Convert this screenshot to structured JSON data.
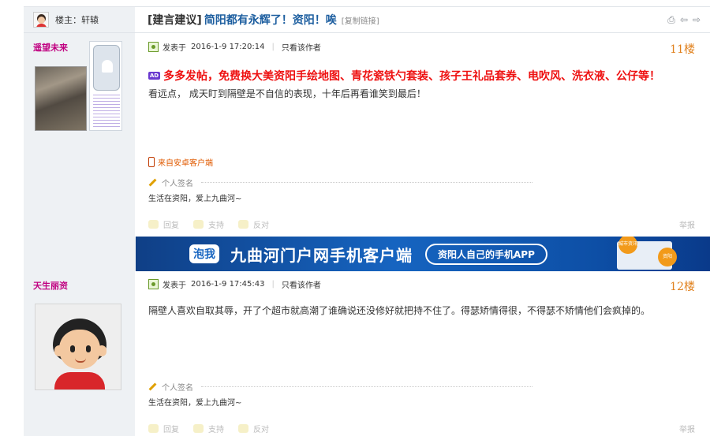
{
  "thread": {
    "op_label": "楼主：轩辕",
    "category": "[建言建议]",
    "title": "简阳都有永辉了！资阳！唉",
    "copy_link": "[复制链接]",
    "tool_icons": [
      "print-icon",
      "prev-thread-icon",
      "next-thread-icon"
    ]
  },
  "posts": [
    {
      "author": "遥望未来",
      "posted_label": "发表于",
      "posted_at": "2016-1-9 17:20:14",
      "author_only": "只看该作者",
      "floor": "11楼",
      "ad_badge": "AD",
      "ad_text": "多多发帖，免费换大美资阳手绘地图、青花瓷铁勺套装、孩子王礼品套券、电吹风、洗衣液、公仔等！",
      "body": "看远点， 成天盯到隔壁是不自信的表现，十年后再看谁笑到最后！",
      "client": "来自安卓客户端",
      "sig_label": "个人签名",
      "signature": "生活在资阳，爱上九曲河~",
      "actions": [
        "回复",
        "支持",
        "反对"
      ],
      "report": "举报"
    },
    {
      "author": "天生丽资",
      "posted_label": "发表于",
      "posted_at": "2016-1-9 17:45:43",
      "author_only": "只看该作者",
      "floor": "12楼",
      "body": "隔壁人喜欢自取其辱，开了个超市就高潮了谁确说还没修好就把持不住了。得瑟矫情得很，不得瑟不矫情他们会疯掉的。",
      "sig_label": "个人签名",
      "signature": "生活在资阳，爱上九曲河~",
      "actions": [
        "回复",
        "支持",
        "反对"
      ],
      "report": "举报"
    }
  ],
  "banner": {
    "logo": "泡我",
    "title": "九曲河门户网手机客户端",
    "pill": "资阳人自己的手机APP",
    "bubble_1": "城市资讯",
    "bubble_2": "资阳"
  },
  "colors": {
    "author_name": "#c00080",
    "floor_number": "#e07f1a",
    "ad_text": "#ee1111",
    "title_link": "#1e5fa0",
    "banner_blue": "#1664c0"
  }
}
